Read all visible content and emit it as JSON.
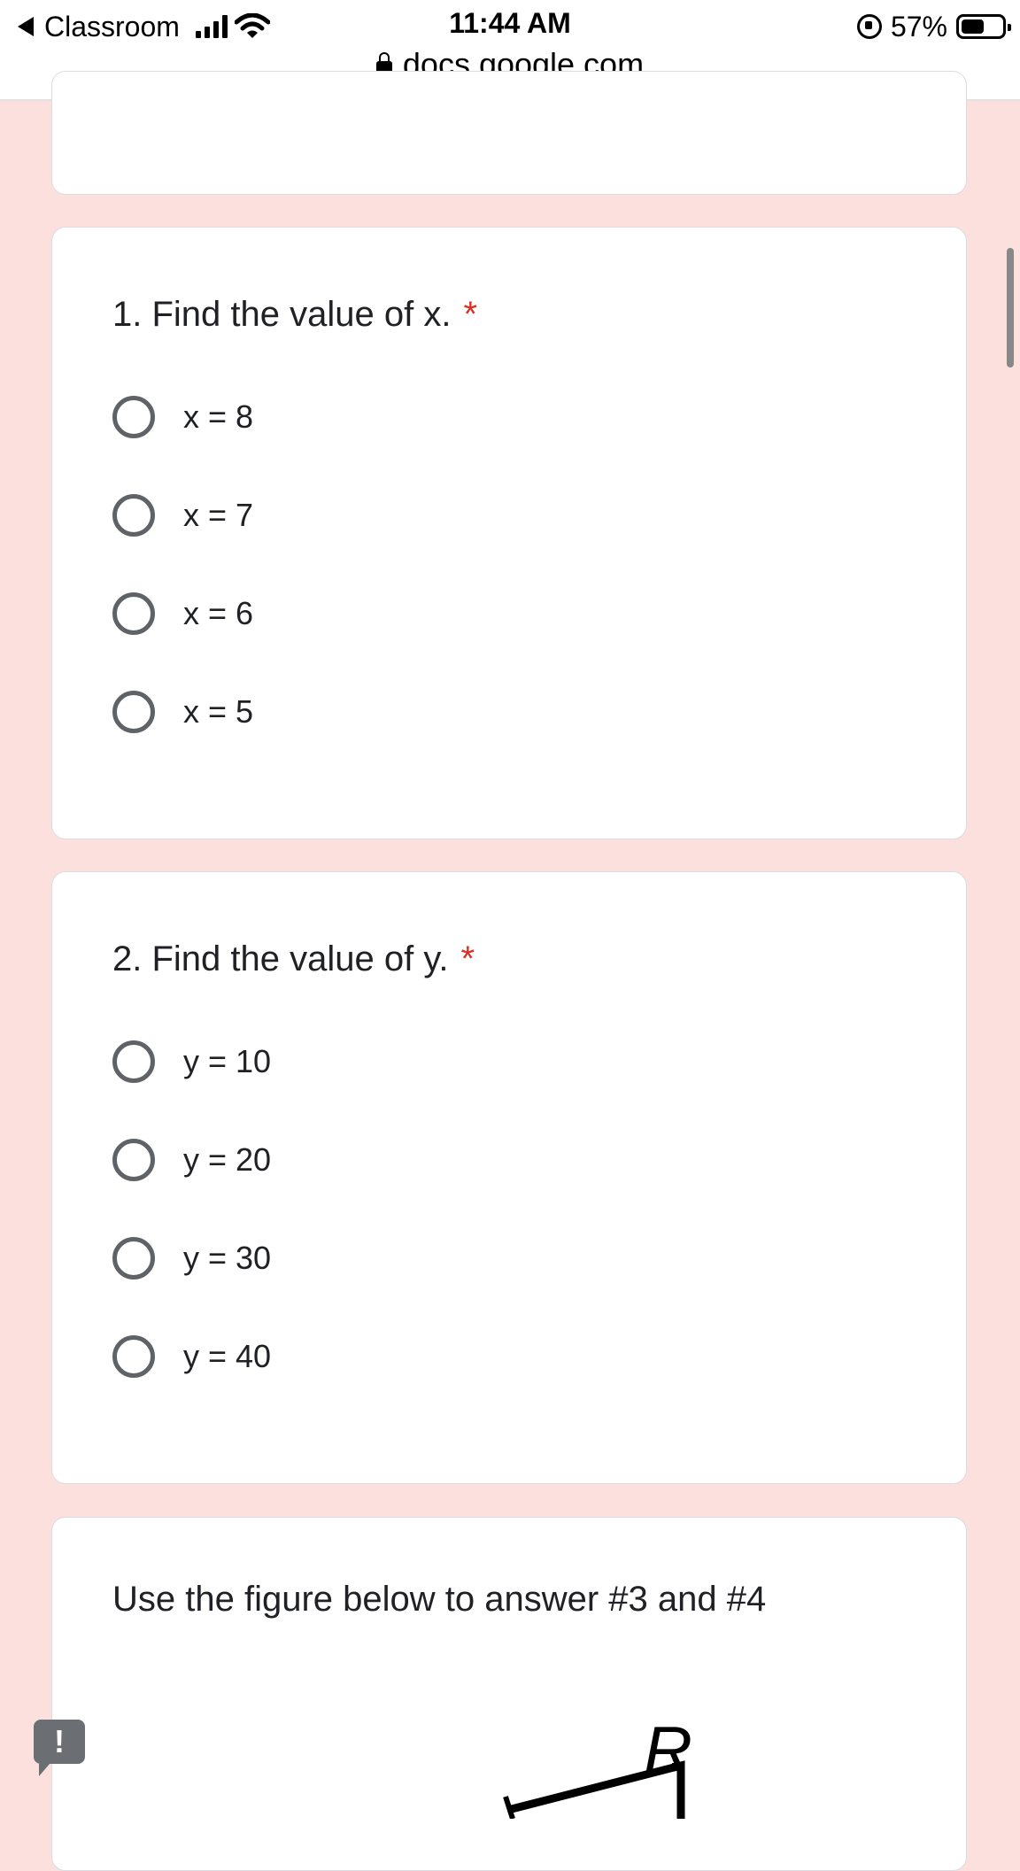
{
  "status_bar": {
    "back_app": "Classroom",
    "time": "11:44 AM",
    "url": "docs.google.com",
    "battery": "57%",
    "battery_level": 0.57
  },
  "questions": [
    {
      "title": "1. Find the value of x.",
      "required_mark": "*",
      "options": [
        "x = 8",
        "x = 7",
        "x = 6",
        "x = 5"
      ]
    },
    {
      "title": "2. Find the value of y.",
      "required_mark": "*",
      "options": [
        "y = 10",
        "y = 20",
        "y = 30",
        "y = 40"
      ]
    }
  ],
  "instruction_card": {
    "text": "Use the figure below to answer #3 and #4",
    "figure_label": "R"
  },
  "feedback_button": {
    "label": "!"
  },
  "colors": {
    "background": "#fbe0dd",
    "required": "#d93025",
    "radio": "#5f6368"
  },
  "icons": [
    "back-arrow-icon",
    "signal-icon",
    "wifi-icon",
    "lock-icon",
    "orientation-lock-icon",
    "battery-icon",
    "feedback-icon"
  ]
}
